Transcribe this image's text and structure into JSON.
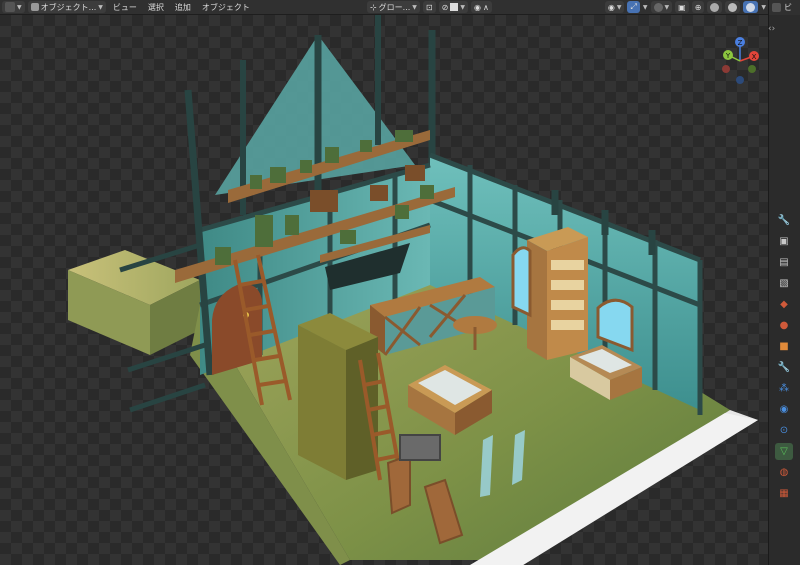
{
  "header": {
    "mode_label": "オブジェクト...",
    "menus": [
      "ビュー",
      "選択",
      "追加",
      "オブジェクト"
    ],
    "transform_orientation": "グロー...",
    "icons": {
      "editor_type": "cube-editor-icon",
      "mode": "object-mode-icon",
      "orientation": "axes-icon",
      "pivot": "pivot-icon",
      "snap": "magnet-icon",
      "proportional": "proportional-icon",
      "visibility": "eye-icon",
      "gizmo": "gizmo-icon",
      "overlay": "overlay-icon",
      "xray": "xray-icon",
      "shading_wire": "wireframe-sphere-icon",
      "shading_solid": "solid-sphere-icon",
      "shading_material": "material-sphere-icon",
      "shading_rendered": "rendered-sphere-icon"
    }
  },
  "navigation_gizmo": {
    "axes": [
      {
        "label": "Y",
        "color": "#8cc63f"
      },
      {
        "label": "X",
        "color": "#e2453a"
      },
      {
        "label": "Z",
        "color": "#4a7fe0"
      }
    ]
  },
  "properties_tabs": [
    {
      "name": "tool-icon",
      "glyph": "🔧"
    },
    {
      "name": "render-icon",
      "glyph": "▣"
    },
    {
      "name": "output-icon",
      "glyph": "▤"
    },
    {
      "name": "view-layer-icon",
      "glyph": "▧"
    },
    {
      "name": "scene-icon",
      "glyph": "◆"
    },
    {
      "name": "world-icon",
      "glyph": "●"
    },
    {
      "name": "object-icon",
      "glyph": "■"
    },
    {
      "name": "modifier-icon",
      "glyph": "🔧"
    },
    {
      "name": "particles-icon",
      "glyph": "⁂"
    },
    {
      "name": "physics-icon",
      "glyph": "◉"
    },
    {
      "name": "constraints-icon",
      "glyph": "⊙"
    },
    {
      "name": "data-icon",
      "glyph": "▽"
    },
    {
      "name": "material-icon",
      "glyph": "◍"
    },
    {
      "name": "texture-icon",
      "glyph": "▦"
    }
  ],
  "colors": {
    "floor": "#8a9a55",
    "wall_glass": "#5fb3b0",
    "beam": "#2c4a48",
    "wood": "#8a5a30",
    "accent": "#4772b3"
  }
}
